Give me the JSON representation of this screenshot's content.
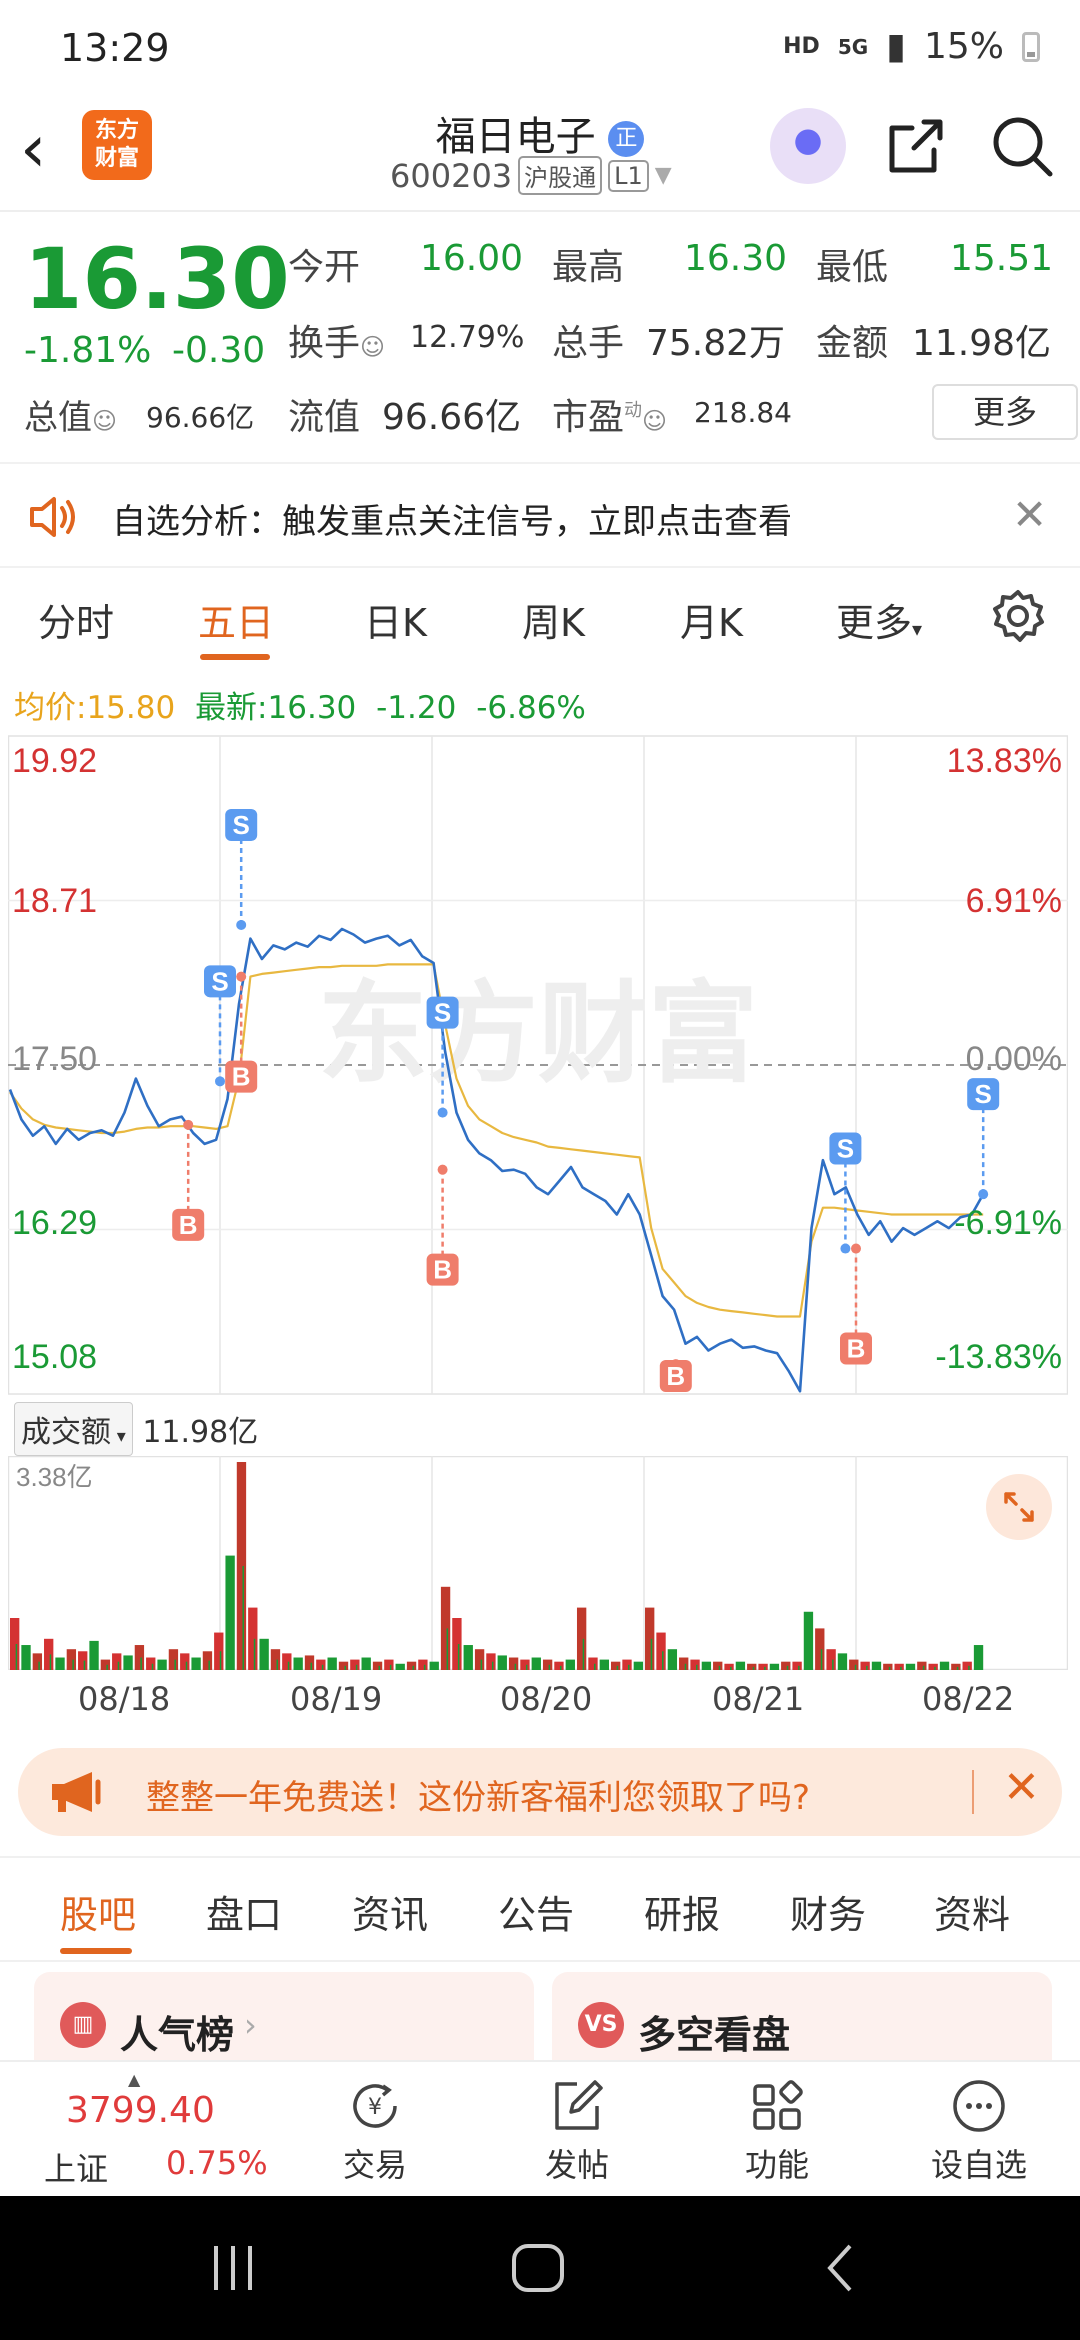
{
  "status_bar": {
    "time": "13:29",
    "network": "HD",
    "signal": "5G",
    "battery": "15%"
  },
  "header": {
    "brand": "东方财富",
    "stock_name": "福日电子",
    "name_badge": "正",
    "stock_code": "600203",
    "tag_connect": "沪股通",
    "tag_level": "L1"
  },
  "quote": {
    "price": "16.30",
    "change_pct": "-1.81%",
    "change_abs": "-0.30",
    "open_label": "今开",
    "open_val": "16.00",
    "high_label": "最高",
    "high_val": "16.30",
    "low_label": "最低",
    "low_val": "15.51",
    "turnover_label": "换手",
    "turnover_val": "12.79%",
    "volume_label": "总手",
    "volume_val": "75.82万",
    "amount_label": "金额",
    "amount_val": "11.98亿",
    "total_cap_label": "总值",
    "total_cap_val": "96.66亿",
    "float_cap_label": "流值",
    "float_cap_val": "96.66亿",
    "pe_label": "市盈",
    "pe_sup": "动",
    "pe_val": "218.84",
    "more_label": "更多"
  },
  "alert": {
    "text": "自选分析：触发重点关注信号，立即点击查看"
  },
  "tabs": [
    "分时",
    "五日",
    "日K",
    "周K",
    "月K",
    "更多"
  ],
  "summary": {
    "avg_label": "均价:",
    "avg_val": "15.80",
    "latest_label": "最新:",
    "latest_val": "16.30",
    "chg": "-1.20",
    "chg_pct": "-6.86%"
  },
  "chart_data": {
    "type": "line",
    "title": "",
    "x": [
      "08/18",
      "08/19",
      "08/20",
      "08/21",
      "08/22"
    ],
    "y_left_ticks": [
      "19.92",
      "18.71",
      "17.50",
      "16.29",
      "15.08"
    ],
    "y_right_ticks": [
      "13.83%",
      "6.91%",
      "0.00%",
      "-6.91%",
      "-13.83%"
    ],
    "ylim": [
      15.08,
      19.92
    ],
    "reference_price": 17.5,
    "series": [
      {
        "values": [
          17.32,
          17.1,
          16.98,
          17.05,
          16.92,
          17.03,
          16.95,
          17.0,
          17.02,
          16.98,
          17.15,
          17.4,
          17.2,
          17.05,
          17.1,
          17.12,
          17.0,
          16.92,
          16.95,
          17.25,
          17.95,
          18.43,
          18.28,
          18.38,
          18.35,
          18.4,
          18.37,
          18.45,
          18.42,
          18.5,
          18.46,
          18.4,
          18.43,
          18.45,
          18.38,
          18.42,
          18.3,
          18.25,
          17.6,
          17.15,
          16.95,
          16.85,
          16.8,
          16.72,
          16.73,
          16.7,
          16.6,
          16.55,
          16.65,
          16.75,
          16.6,
          16.55,
          16.5,
          16.4,
          16.55,
          16.4,
          16.1,
          15.8,
          15.7,
          15.45,
          15.5,
          15.4,
          15.45,
          15.48,
          15.42,
          15.43,
          15.4,
          15.38,
          15.25,
          15.1,
          16.3,
          16.8,
          16.55,
          16.6,
          16.4,
          16.25,
          16.35,
          16.2,
          16.3,
          16.25,
          16.3,
          16.35,
          16.3,
          16.38,
          16.4,
          16.55
        ]
      },
      {
        "values": [
          17.3,
          17.18,
          17.1,
          17.06,
          17.04,
          17.03,
          17.02,
          17.01,
          17.0,
          17.0,
          17.01,
          17.03,
          17.04,
          17.04,
          17.05,
          17.05,
          17.05,
          17.04,
          17.03,
          17.05,
          17.4,
          18.15,
          18.17,
          18.18,
          18.19,
          18.2,
          18.21,
          18.22,
          18.22,
          18.23,
          18.23,
          18.23,
          18.23,
          18.24,
          18.24,
          18.24,
          18.24,
          18.24,
          17.8,
          17.4,
          17.2,
          17.1,
          17.05,
          17.0,
          16.97,
          16.95,
          16.93,
          16.9,
          16.89,
          16.88,
          16.87,
          16.86,
          16.85,
          16.84,
          16.83,
          16.82,
          16.3,
          16.0,
          15.9,
          15.8,
          15.75,
          15.72,
          15.7,
          15.69,
          15.68,
          15.67,
          15.66,
          15.65,
          15.65,
          15.65,
          16.2,
          16.45,
          16.45,
          16.44,
          16.43,
          16.42,
          16.41,
          16.4,
          16.4,
          16.4,
          16.4,
          16.4,
          16.4,
          16.4,
          16.4,
          16.4
        ]
      }
    ],
    "signals": [
      {
        "label": "B",
        "x": 0.17,
        "y": 17.06
      },
      {
        "label": "S",
        "x": 0.2,
        "y": 17.38
      },
      {
        "label": "S",
        "x": 0.22,
        "y": 18.53
      },
      {
        "label": "B",
        "x": 0.22,
        "y": 18.15
      },
      {
        "label": "S",
        "x": 0.41,
        "y": 17.15
      },
      {
        "label": "B",
        "x": 0.41,
        "y": 16.73
      },
      {
        "label": "B",
        "x": 0.63,
        "y": 15.3
      },
      {
        "label": "S",
        "x": 0.79,
        "y": 16.15
      },
      {
        "label": "B",
        "x": 0.8,
        "y": 16.15
      },
      {
        "label": "S",
        "x": 0.92,
        "y": 16.55
      }
    ],
    "colors": {
      "price_line": "#2f6fc4",
      "avg_line": "#e8b840",
      "buy": "#ef7d6b",
      "sell": "#5b9bf0"
    }
  },
  "volume": {
    "label": "成交额",
    "total": "11.98亿",
    "max_tick": "3.38亿",
    "bars": [
      0.25,
      0.12,
      0.08,
      0.15,
      0.06,
      0.1,
      0.09,
      0.14,
      0.05,
      0.08,
      0.07,
      0.12,
      0.06,
      0.05,
      0.1,
      0.08,
      0.06,
      0.09,
      0.18,
      0.55,
      1.0,
      0.3,
      0.15,
      0.1,
      0.08,
      0.06,
      0.07,
      0.05,
      0.06,
      0.04,
      0.05,
      0.06,
      0.04,
      0.05,
      0.03,
      0.04,
      0.05,
      0.04,
      0.4,
      0.25,
      0.12,
      0.1,
      0.08,
      0.07,
      0.06,
      0.05,
      0.06,
      0.05,
      0.04,
      0.05,
      0.3,
      0.06,
      0.05,
      0.04,
      0.05,
      0.04,
      0.3,
      0.18,
      0.1,
      0.06,
      0.05,
      0.04,
      0.04,
      0.03,
      0.04,
      0.03,
      0.03,
      0.03,
      0.04,
      0.04,
      0.28,
      0.2,
      0.1,
      0.08,
      0.05,
      0.04,
      0.04,
      0.03,
      0.03,
      0.03,
      0.04,
      0.03,
      0.04,
      0.03,
      0.04,
      0.12
    ]
  },
  "promo": {
    "text": "整整一年免费送！这份新客福利您领取了吗?"
  },
  "bottom_tabs": [
    "股吧",
    "盘口",
    "资讯",
    "公告",
    "研报",
    "财务",
    "资料"
  ],
  "cards": [
    {
      "title": "人气榜",
      "icon": "bar-chart-icon"
    },
    {
      "title": "多空看盘",
      "icon_text": "VS"
    }
  ],
  "bottom_nav": {
    "index_value": "3799.40",
    "index_name": "上证",
    "index_pct": "0.75%",
    "items": [
      "交易",
      "发帖",
      "功能",
      "设自选"
    ]
  },
  "watermark": "东方财富"
}
